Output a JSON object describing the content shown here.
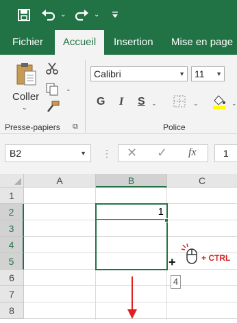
{
  "qat": {
    "save_icon": "save-icon",
    "undo_icon": "undo-icon",
    "redo_icon": "redo-icon",
    "customize_icon": "customize-qat-icon"
  },
  "tabs": [
    {
      "label": "Fichier",
      "active": false
    },
    {
      "label": "Accueil",
      "active": true
    },
    {
      "label": "Insertion",
      "active": false
    },
    {
      "label": "Mise en page",
      "active": false
    }
  ],
  "clipboard": {
    "paste_label": "Coller",
    "group_label": "Presse-papiers"
  },
  "font": {
    "font_name": "Calibri",
    "font_size": "11",
    "bold": "G",
    "italic": "I",
    "underline": "S",
    "group_label": "Police"
  },
  "formula_bar": {
    "name_box": "B2",
    "fx_label": "fx",
    "content": "1"
  },
  "grid": {
    "columns": [
      "A",
      "B",
      "C"
    ],
    "rows": [
      "1",
      "2",
      "3",
      "4",
      "5",
      "6",
      "7",
      "8"
    ],
    "cells": {
      "B2": "1"
    },
    "fill_tooltip": "4"
  },
  "annotation": {
    "ctrl_label": "+ CTRL",
    "arrow_color": "#e02020"
  },
  "colors": {
    "accent": "#217346"
  }
}
